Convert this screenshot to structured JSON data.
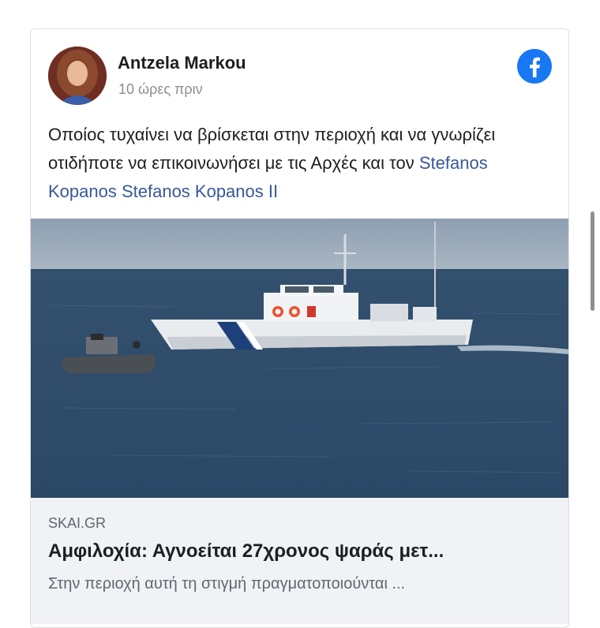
{
  "post": {
    "author": "Antzela Markou",
    "time": "10 ώρες πριν",
    "text_prefix": "Οποίος τυχαίνει να βρίσκεται στην περιοχή και να γνωρίζει οτιδήποτε να επικοινωνήσει με τις Αρχές και τον ",
    "mention": "Stefanos Kopanos Stefanos Kopanos II"
  },
  "link": {
    "domain": "SKAI.GR",
    "headline": "Αμφιλοχία: Αγνοείται 27χρονος ψαράς μετ...",
    "description": "Στην περιοχή αυτή τη στιγμή πραγματοποιούνται ..."
  },
  "icons": {
    "platform": "facebook-icon"
  },
  "colors": {
    "facebook_blue": "#1877f2",
    "mention": "#385898",
    "link_bg": "#f0f2f5"
  }
}
